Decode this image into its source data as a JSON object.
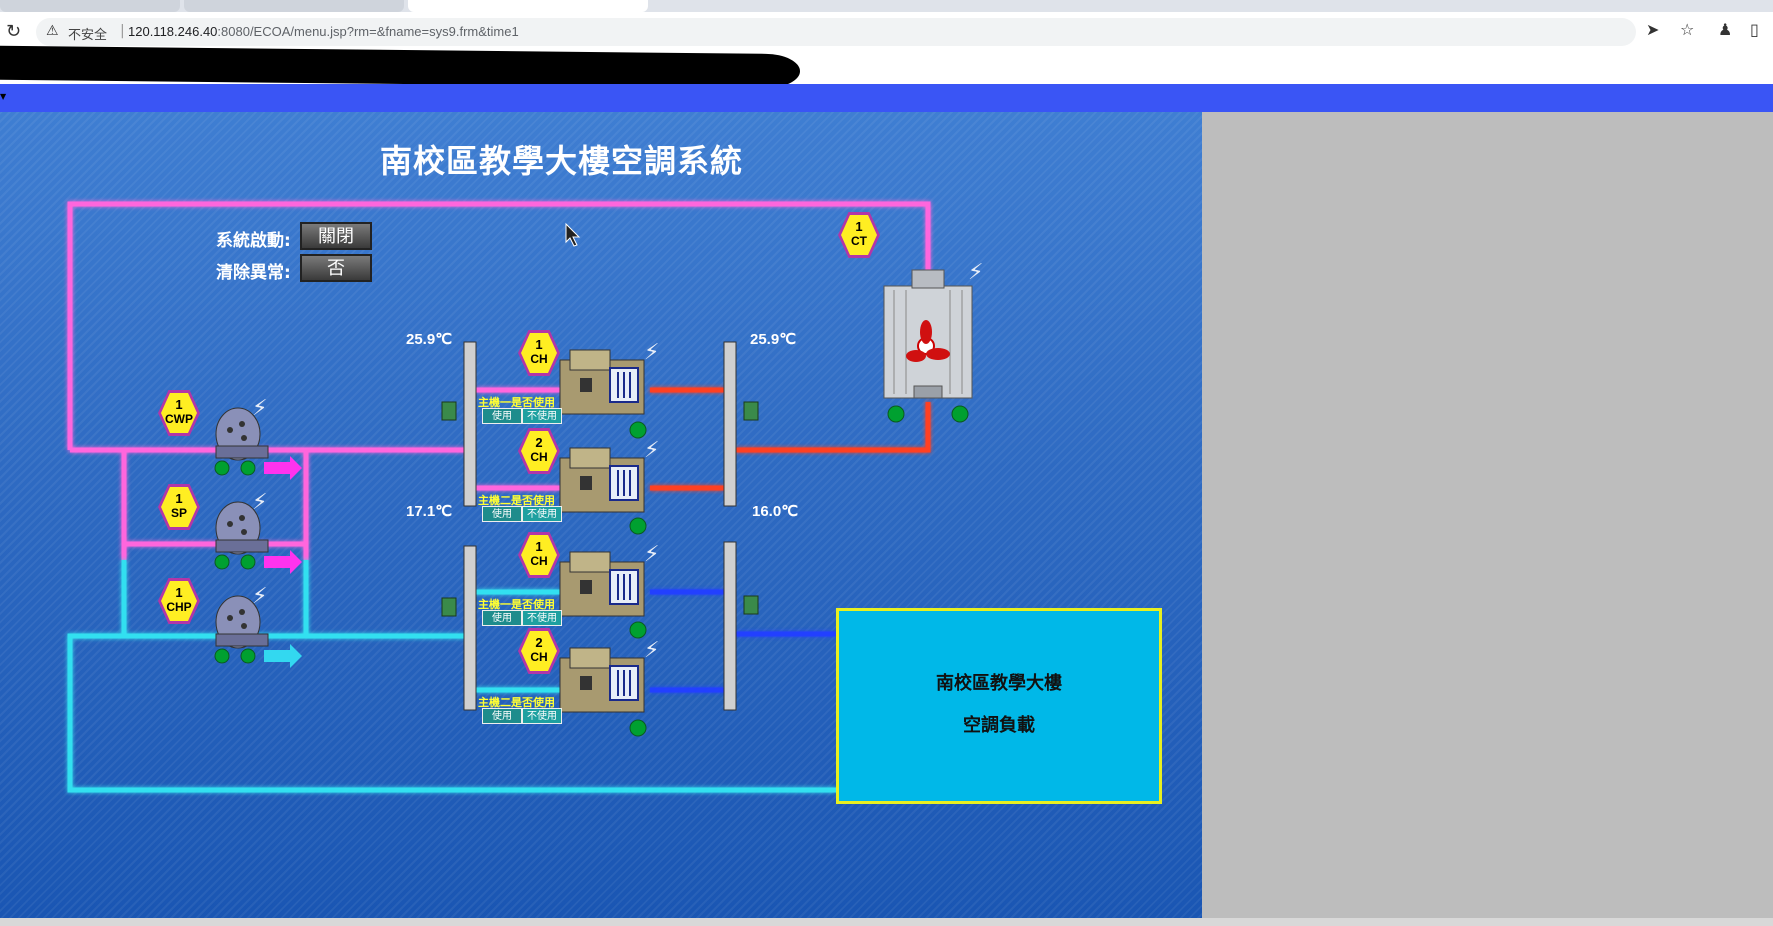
{
  "browser": {
    "security_label": "不安全",
    "url_host": "120.118.246.40",
    "url_rest": ":8080/ECOA/menu.jsp?rm=&fname=sys9.frm&time1"
  },
  "page": {
    "title": "南校區教學大樓空調系統"
  },
  "controls": {
    "system_start_label": "系統啟動:",
    "system_start_value": "關閉",
    "clear_alarm_label": "清除異常:",
    "clear_alarm_value": "否"
  },
  "temperatures": {
    "cw_inlet": "25.9℃",
    "cw_outlet": "25.9℃",
    "chw_return": "17.1℃",
    "chw_supply": "16.0℃"
  },
  "equipment": {
    "ct": {
      "num": "1",
      "code": "CT"
    },
    "cwp": {
      "num": "1",
      "code": "CWP"
    },
    "sp": {
      "num": "1",
      "code": "SP"
    },
    "chp": {
      "num": "1",
      "code": "CHP"
    },
    "ch_upper_1": {
      "num": "1",
      "code": "CH",
      "label": "主機一是否使用"
    },
    "ch_upper_2": {
      "num": "2",
      "code": "CH",
      "label": "主機二是否使用"
    },
    "ch_lower_1": {
      "num": "1",
      "code": "CH",
      "label": "主機一是否使用"
    },
    "ch_lower_2": {
      "num": "2",
      "code": "CH",
      "label": "主機二是否使用"
    }
  },
  "switch": {
    "use": "使用",
    "nouse": "不使用"
  },
  "load": {
    "line1": "南校區教學大樓",
    "line2": "空調負載"
  },
  "colors": {
    "cw_pipe": "#ff66dd",
    "chw_pipe": "#33e0f0",
    "hot_pipe": "#ff4020",
    "cold_pipe": "#2040ff",
    "status_on": "#00a030",
    "brand_bar": "#3a55f5"
  }
}
